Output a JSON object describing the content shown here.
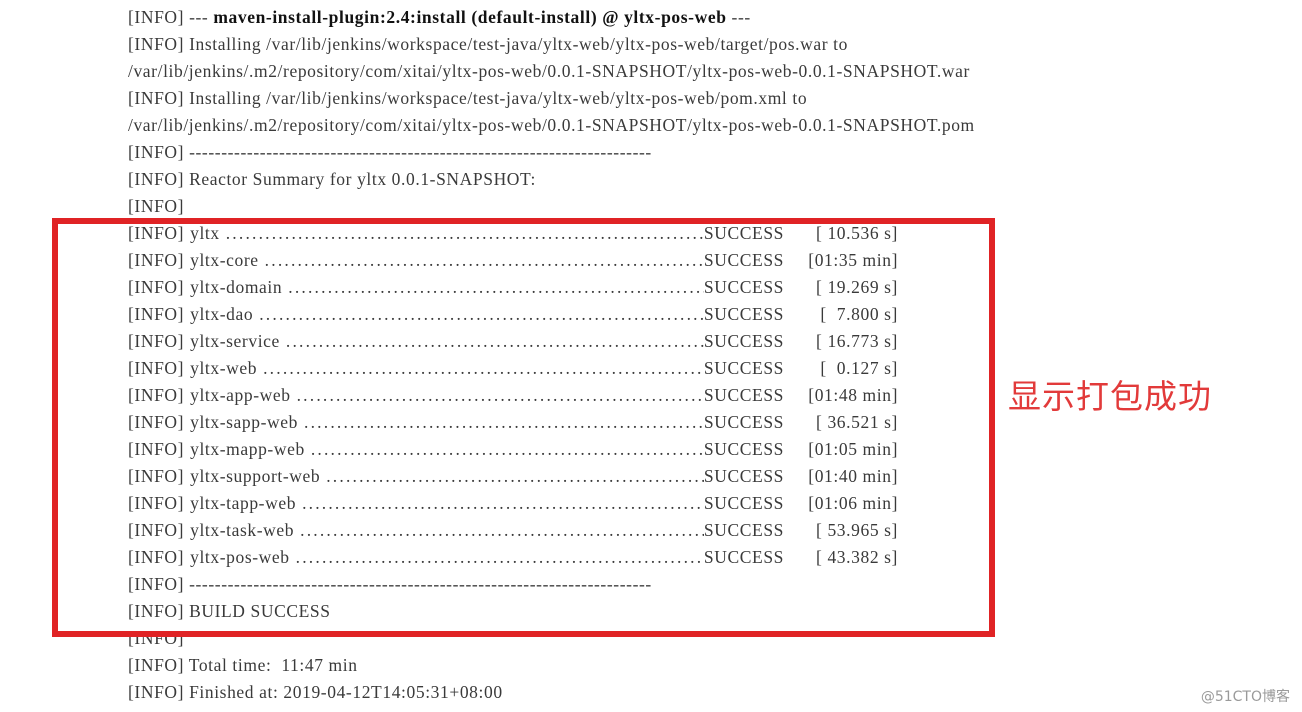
{
  "console": {
    "info_tag": "[INFO]",
    "header_lines": [
      {
        "tag": "[INFO]",
        "prefix": " --- ",
        "bold": "maven-install-plugin:2.4:install (default-install) @ yltx-pos-web",
        "suffix": " ---"
      },
      {
        "tag": "[INFO]",
        "text": " Installing /var/lib/jenkins/workspace/test-java/yltx-web/yltx-pos-web/target/pos.war to"
      },
      {
        "tag": "",
        "text": "/var/lib/jenkins/.m2/repository/com/xitai/yltx-pos-web/0.0.1-SNAPSHOT/yltx-pos-web-0.0.1-SNAPSHOT.war"
      },
      {
        "tag": "[INFO]",
        "text": " Installing /var/lib/jenkins/workspace/test-java/yltx-web/yltx-pos-web/pom.xml to"
      },
      {
        "tag": "",
        "text": "/var/lib/jenkins/.m2/repository/com/xitai/yltx-pos-web/0.0.1-SNAPSHOT/yltx-pos-web-0.0.1-SNAPSHOT.pom"
      },
      {
        "tag": "[INFO]",
        "text": " ------------------------------------------------------------------------"
      },
      {
        "tag": "[INFO]",
        "text": " Reactor Summary for yltx 0.0.1-SNAPSHOT:"
      },
      {
        "tag": "[INFO]",
        "text": ""
      }
    ],
    "reactor_summary": {
      "title": "Reactor Summary for yltx 0.0.1-SNAPSHOT:",
      "dots": "........................................................................................",
      "modules": [
        {
          "tag": "[INFO]",
          "name": "yltx",
          "status": "SUCCESS",
          "time": "[ 10.536 s]"
        },
        {
          "tag": "[INFO]",
          "name": "yltx-core",
          "status": "SUCCESS",
          "time": "[01:35 min]"
        },
        {
          "tag": "[INFO]",
          "name": "yltx-domain",
          "status": "SUCCESS",
          "time": "[ 19.269 s]"
        },
        {
          "tag": "[INFO]",
          "name": "yltx-dao",
          "status": "SUCCESS",
          "time": "[  7.800 s]"
        },
        {
          "tag": "[INFO]",
          "name": "yltx-service",
          "status": "SUCCESS",
          "time": "[ 16.773 s]"
        },
        {
          "tag": "[INFO]",
          "name": "yltx-web",
          "status": "SUCCESS",
          "time": "[  0.127 s]"
        },
        {
          "tag": "[INFO]",
          "name": "yltx-app-web",
          "status": "SUCCESS",
          "time": "[01:48 min]"
        },
        {
          "tag": "[INFO]",
          "name": "yltx-sapp-web",
          "status": "SUCCESS",
          "time": "[ 36.521 s]"
        },
        {
          "tag": "[INFO]",
          "name": "yltx-mapp-web",
          "status": "SUCCESS",
          "time": "[01:05 min]"
        },
        {
          "tag": "[INFO]",
          "name": "yltx-support-web",
          "status": "SUCCESS",
          "time": "[01:40 min]"
        },
        {
          "tag": "[INFO]",
          "name": "yltx-tapp-web",
          "status": "SUCCESS",
          "time": "[01:06 min]"
        },
        {
          "tag": "[INFO]",
          "name": "yltx-task-web",
          "status": "SUCCESS",
          "time": "[ 53.965 s]"
        },
        {
          "tag": "[INFO]",
          "name": "yltx-pos-web",
          "status": "SUCCESS",
          "time": "[ 43.382 s]"
        }
      ]
    },
    "footer_lines": [
      {
        "tag": "[INFO]",
        "text": " ------------------------------------------------------------------------"
      },
      {
        "tag": "[INFO]",
        "text": " BUILD SUCCESS"
      },
      {
        "tag": "[INFO]",
        "text": ""
      },
      {
        "tag": "[INFO]",
        "text": " Total time:  11:47 min"
      },
      {
        "tag": "[INFO]",
        "text": " Finished at: 2019-04-12T14:05:31+08:00"
      }
    ]
  },
  "annotation": {
    "text": "显示打包成功",
    "color": "#E23A3A"
  },
  "highlight_box": {
    "color": "#E02325"
  },
  "watermark": {
    "text": "@51CTO博客"
  }
}
